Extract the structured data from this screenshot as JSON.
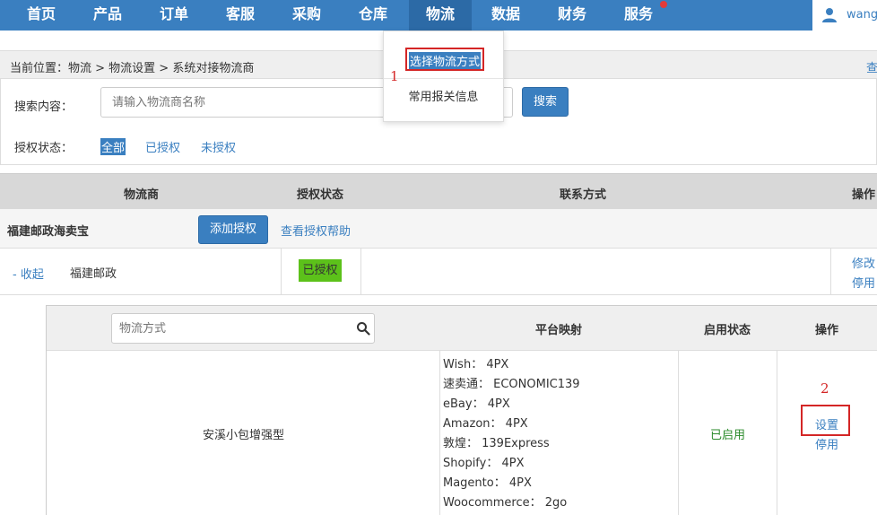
{
  "nav": {
    "items": [
      "首页",
      "产品",
      "订单",
      "客服",
      "采购",
      "仓库",
      "物流",
      "数据",
      "财务",
      "服务"
    ],
    "active_index": 6,
    "user_name": "wang",
    "notification_color": "#e23b3b"
  },
  "dropdown": {
    "item1": "选择物流方式",
    "item2": "常用报关信息"
  },
  "annotations": {
    "one": "1",
    "two": "2"
  },
  "breadcrumb": {
    "text": "当前位置：物流 > 物流设置 > 系统对接物流商",
    "right": "查"
  },
  "search": {
    "label": "搜索内容：",
    "placeholder": "请输入物流商名称",
    "button": "搜索"
  },
  "auth_filter": {
    "label": "授权状态：",
    "options": [
      "全部",
      "已授权",
      "未授权"
    ],
    "selected": 0
  },
  "table": {
    "headers": [
      "物流商",
      "授权状态",
      "联系方式",
      "操作"
    ]
  },
  "group": {
    "name": "福建邮政海卖宝",
    "add_button": "添加授权",
    "help_link": "查看授权帮助"
  },
  "provider": {
    "collapse": "- 收起",
    "name": "福建邮政",
    "auth_badge": "已授权",
    "edit": "修改",
    "stop": "停用"
  },
  "sub_table": {
    "search_placeholder": "物流方式",
    "headers": [
      "平台映射",
      "启用状态",
      "操作"
    ],
    "row": {
      "name": "安溪小包增强型",
      "mappings": [
        "Wish： 4PX",
        "速卖通： ECONOMIC139",
        "eBay： 4PX",
        "Amazon： 4PX",
        "敦煌： 139Express",
        "Shopify： 4PX",
        "Magento： 4PX",
        "Woocommerce： 2go"
      ],
      "status": "已启用",
      "set": "设置",
      "stop": "停用"
    }
  },
  "colors": {
    "nav_bg": "#3a7fc0",
    "highlight": "#d42626",
    "auth_green": "#5cc11a"
  }
}
